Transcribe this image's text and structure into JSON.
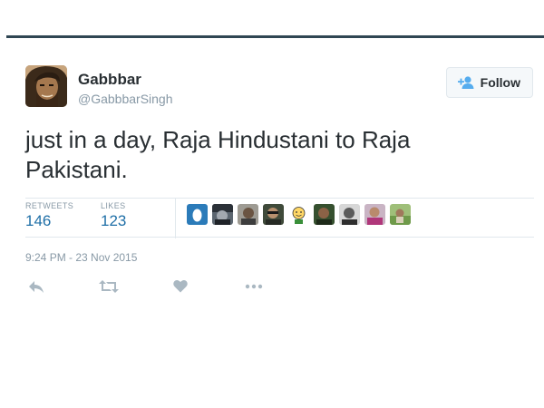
{
  "tweet": {
    "author_name": "Gabbbar",
    "author_handle": "@GabbbarSingh",
    "follow_label": "Follow",
    "text": "just in a day, Raja Hindustani to Raja Pakistani.",
    "retweets_label": "RETWEETS",
    "retweets_count": "146",
    "likes_label": "LIKES",
    "likes_count": "123",
    "timestamp": "9:24 PM - 23 Nov 2015"
  },
  "likers": [
    {
      "name": "liker-avatar-egg"
    },
    {
      "name": "liker-avatar-2"
    },
    {
      "name": "liker-avatar-3"
    },
    {
      "name": "liker-avatar-4"
    },
    {
      "name": "liker-avatar-smiley"
    },
    {
      "name": "liker-avatar-6"
    },
    {
      "name": "liker-avatar-7"
    },
    {
      "name": "liker-avatar-8"
    },
    {
      "name": "liker-avatar-9"
    }
  ],
  "actions": [
    "reply-icon",
    "retweet-icon",
    "like-icon",
    "more-icon"
  ],
  "colors": {
    "accent": "#1f6fa7",
    "follow_icon": "#55acee",
    "muted": "#8899a6",
    "divider": "#e1e8ed",
    "top_rule": "#2f4653"
  }
}
